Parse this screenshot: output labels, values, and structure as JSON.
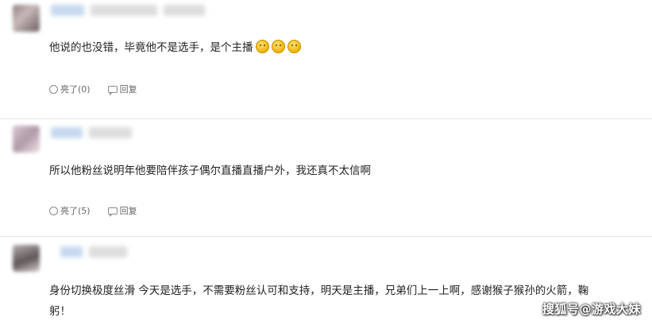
{
  "comments": [
    {
      "text": "他说的也没错，毕竟他不是选手，是个主播",
      "emojis": [
        "thinking-face-icon",
        "thinking-face-icon",
        "thinking-face-icon"
      ],
      "likes": "亮了(0)",
      "reply": "回复"
    },
    {
      "text": "所以他粉丝说明年他要陪伴孩子偶尔直播直播户外，我还真不太信啊",
      "likes": "亮了(5)",
      "reply": "回复"
    },
    {
      "text_line1": "身份切换极度丝滑 今天是选手，不需要粉丝认可和支持，明天是主播，兄弟们上一上啊，感谢猴子猴孙的火箭，鞠",
      "text_line2": "躬！"
    }
  ],
  "watermark": "搜狐号@游戏大妹"
}
